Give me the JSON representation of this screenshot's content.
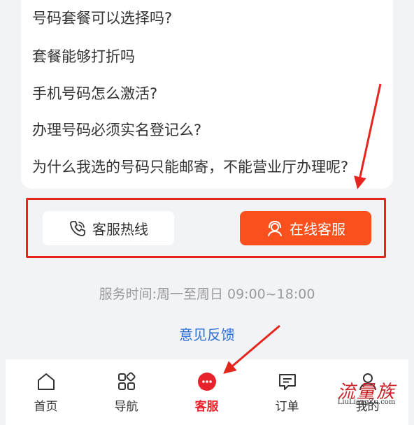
{
  "faq": {
    "items": [
      "号码套餐可以选择吗?",
      "套餐能够打折吗",
      "手机号码怎么激活?",
      "办理号码必须实名登记么?",
      "为什么我选的号码只能邮寄，不能营业厅办理呢?"
    ]
  },
  "actions": {
    "hotline_label": "客服热线",
    "online_label": "在线客服"
  },
  "service_time": "服务时间:周一至周日 09:00~18:00",
  "feedback_label": "意见反馈",
  "tabbar": {
    "tabs": [
      {
        "label": "首页",
        "icon": "home-icon"
      },
      {
        "label": "导航",
        "icon": "grid-icon"
      },
      {
        "label": "客服",
        "icon": "chat-bubble-icon",
        "active": true
      },
      {
        "label": "订单",
        "icon": "message-list-icon"
      },
      {
        "label": "我的",
        "icon": "user-icon"
      }
    ]
  },
  "watermark": {
    "title": "流量族",
    "url": "LiuLiangZu.com"
  },
  "colors": {
    "accent": "#f9501e",
    "active_tab": "#e8222a",
    "annotation": "#e5261d",
    "link": "#2d6fd8"
  }
}
